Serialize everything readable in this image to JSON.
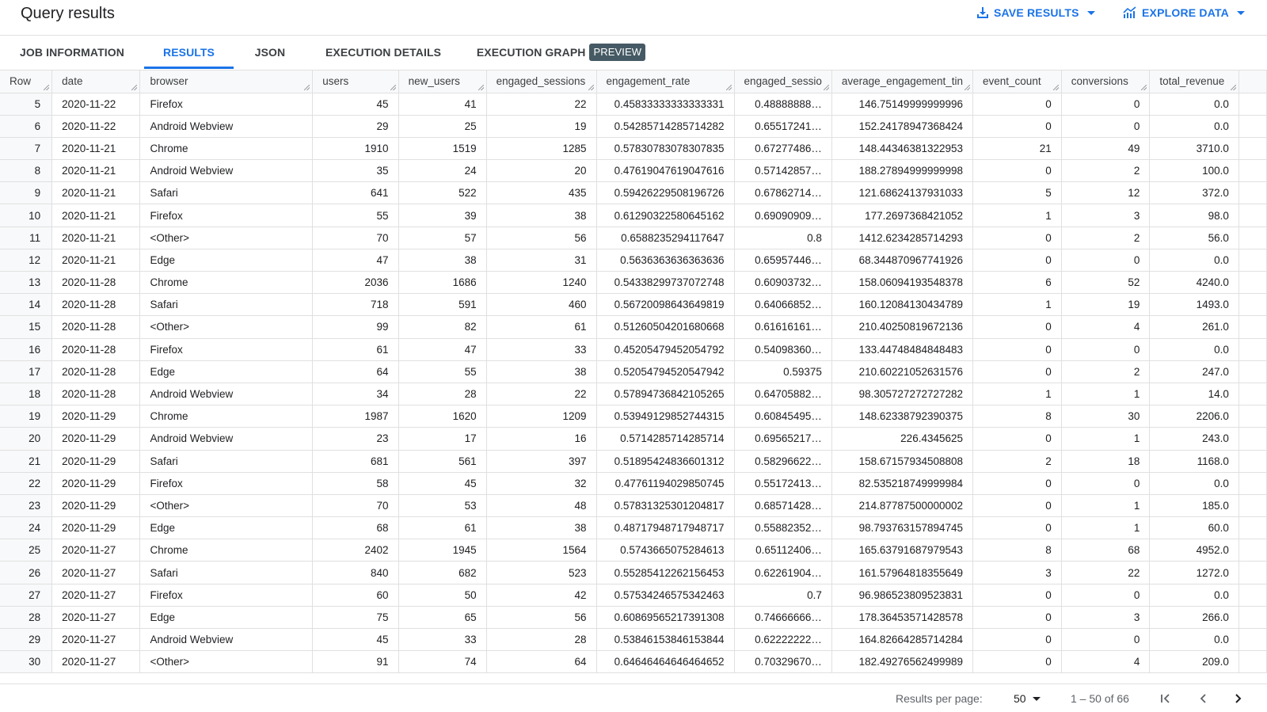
{
  "header": {
    "title": "Query results",
    "save_results_label": "SAVE RESULTS",
    "explore_data_label": "EXPLORE DATA",
    "accent_color": "#1a73e8"
  },
  "tabs": [
    {
      "label": "JOB INFORMATION",
      "active": false
    },
    {
      "label": "RESULTS",
      "active": true
    },
    {
      "label": "JSON",
      "active": false
    },
    {
      "label": "EXECUTION DETAILS",
      "active": false
    },
    {
      "label": "EXECUTION GRAPH",
      "active": false,
      "badge": "PREVIEW"
    }
  ],
  "table": {
    "columns": [
      "Row",
      "date",
      "browser",
      "users",
      "new_users",
      "engaged_sessions",
      "engagement_rate",
      "engaged_sessio",
      "average_engagement_tin",
      "event_count",
      "conversions",
      "total_revenue"
    ],
    "rows": [
      [
        "5",
        "2020-11-22",
        "Firefox",
        "45",
        "41",
        "22",
        "0.45833333333333331",
        "0.48888888…",
        "146.75149999999996",
        "0",
        "0",
        "0.0"
      ],
      [
        "6",
        "2020-11-22",
        "Android Webview",
        "29",
        "25",
        "19",
        "0.54285714285714282",
        "0.65517241…",
        "152.24178947368424",
        "0",
        "0",
        "0.0"
      ],
      [
        "7",
        "2020-11-21",
        "Chrome",
        "1910",
        "1519",
        "1285",
        "0.57830783078307835",
        "0.67277486…",
        "148.44346381322953",
        "21",
        "49",
        "3710.0"
      ],
      [
        "8",
        "2020-11-21",
        "Android Webview",
        "35",
        "24",
        "20",
        "0.47619047619047616",
        "0.57142857…",
        "188.27894999999998",
        "0",
        "2",
        "100.0"
      ],
      [
        "9",
        "2020-11-21",
        "Safari",
        "641",
        "522",
        "435",
        "0.59426229508196726",
        "0.67862714…",
        "121.68624137931033",
        "5",
        "12",
        "372.0"
      ],
      [
        "10",
        "2020-11-21",
        "Firefox",
        "55",
        "39",
        "38",
        "0.61290322580645162",
        "0.69090909…",
        "177.2697368421052",
        "1",
        "3",
        "98.0"
      ],
      [
        "11",
        "2020-11-21",
        "<Other>",
        "70",
        "57",
        "56",
        "0.6588235294117647",
        "0.8",
        "1412.6234285714293",
        "0",
        "2",
        "56.0"
      ],
      [
        "12",
        "2020-11-21",
        "Edge",
        "47",
        "38",
        "31",
        "0.5636363636363636",
        "0.65957446…",
        "68.344870967741926",
        "0",
        "0",
        "0.0"
      ],
      [
        "13",
        "2020-11-28",
        "Chrome",
        "2036",
        "1686",
        "1240",
        "0.54338299737072748",
        "0.60903732…",
        "158.06094193548378",
        "6",
        "52",
        "4240.0"
      ],
      [
        "14",
        "2020-11-28",
        "Safari",
        "718",
        "591",
        "460",
        "0.56720098643649819",
        "0.64066852…",
        "160.12084130434789",
        "1",
        "19",
        "1493.0"
      ],
      [
        "15",
        "2020-11-28",
        "<Other>",
        "99",
        "82",
        "61",
        "0.51260504201680668",
        "0.61616161…",
        "210.40250819672136",
        "0",
        "4",
        "261.0"
      ],
      [
        "16",
        "2020-11-28",
        "Firefox",
        "61",
        "47",
        "33",
        "0.45205479452054792",
        "0.54098360…",
        "133.44748484848483",
        "0",
        "0",
        "0.0"
      ],
      [
        "17",
        "2020-11-28",
        "Edge",
        "64",
        "55",
        "38",
        "0.52054794520547942",
        "0.59375",
        "210.60221052631576",
        "0",
        "2",
        "247.0"
      ],
      [
        "18",
        "2020-11-28",
        "Android Webview",
        "34",
        "28",
        "22",
        "0.57894736842105265",
        "0.64705882…",
        "98.305727272727282",
        "1",
        "1",
        "14.0"
      ],
      [
        "19",
        "2020-11-29",
        "Chrome",
        "1987",
        "1620",
        "1209",
        "0.53949129852744315",
        "0.60845495…",
        "148.62338792390375",
        "8",
        "30",
        "2206.0"
      ],
      [
        "20",
        "2020-11-29",
        "Android Webview",
        "23",
        "17",
        "16",
        "0.5714285714285714",
        "0.69565217…",
        "226.4345625",
        "0",
        "1",
        "243.0"
      ],
      [
        "21",
        "2020-11-29",
        "Safari",
        "681",
        "561",
        "397",
        "0.51895424836601312",
        "0.58296622…",
        "158.67157934508808",
        "2",
        "18",
        "1168.0"
      ],
      [
        "22",
        "2020-11-29",
        "Firefox",
        "58",
        "45",
        "32",
        "0.47761194029850745",
        "0.55172413…",
        "82.535218749999984",
        "0",
        "0",
        "0.0"
      ],
      [
        "23",
        "2020-11-29",
        "<Other>",
        "70",
        "53",
        "48",
        "0.57831325301204817",
        "0.68571428…",
        "214.87787500000002",
        "0",
        "1",
        "185.0"
      ],
      [
        "24",
        "2020-11-29",
        "Edge",
        "68",
        "61",
        "38",
        "0.48717948717948717",
        "0.55882352…",
        "98.793763157894745",
        "0",
        "1",
        "60.0"
      ],
      [
        "25",
        "2020-11-27",
        "Chrome",
        "2402",
        "1945",
        "1564",
        "0.5743665075284613",
        "0.65112406…",
        "165.63791687979543",
        "8",
        "68",
        "4952.0"
      ],
      [
        "26",
        "2020-11-27",
        "Safari",
        "840",
        "682",
        "523",
        "0.55285412262156453",
        "0.62261904…",
        "161.57964818355649",
        "3",
        "22",
        "1272.0"
      ],
      [
        "27",
        "2020-11-27",
        "Firefox",
        "60",
        "50",
        "42",
        "0.57534246575342463",
        "0.7",
        "96.986523809523831",
        "0",
        "0",
        "0.0"
      ],
      [
        "28",
        "2020-11-27",
        "Edge",
        "75",
        "65",
        "56",
        "0.60869565217391308",
        "0.74666666…",
        "178.36453571428578",
        "0",
        "3",
        "266.0"
      ],
      [
        "29",
        "2020-11-27",
        "Android Webview",
        "45",
        "33",
        "28",
        "0.53846153846153844",
        "0.62222222…",
        "164.82664285714284",
        "0",
        "0",
        "0.0"
      ],
      [
        "30",
        "2020-11-27",
        "<Other>",
        "91",
        "74",
        "64",
        "0.64646464646464652",
        "0.70329670…",
        "182.49276562499989",
        "0",
        "4",
        "209.0"
      ]
    ]
  },
  "footer": {
    "results_per_page_label": "Results per page:",
    "results_per_page_value": "50",
    "range_text": "1 – 50 of 66"
  }
}
